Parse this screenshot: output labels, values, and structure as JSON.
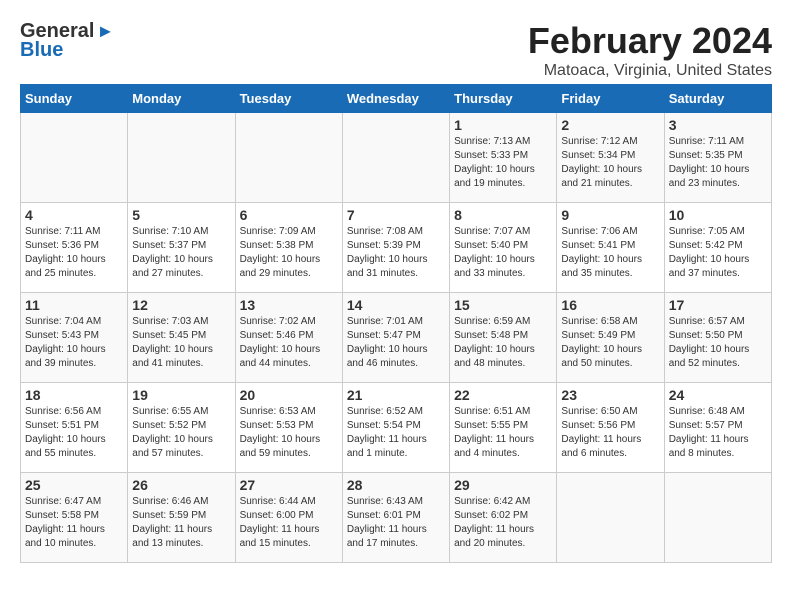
{
  "logo": {
    "line1": "General",
    "line2": "Blue"
  },
  "header": {
    "title": "February 2024",
    "subtitle": "Matoaca, Virginia, United States"
  },
  "weekdays": [
    "Sunday",
    "Monday",
    "Tuesday",
    "Wednesday",
    "Thursday",
    "Friday",
    "Saturday"
  ],
  "weeks": [
    [
      {
        "day": "",
        "info": ""
      },
      {
        "day": "",
        "info": ""
      },
      {
        "day": "",
        "info": ""
      },
      {
        "day": "",
        "info": ""
      },
      {
        "day": "1",
        "info": "Sunrise: 7:13 AM\nSunset: 5:33 PM\nDaylight: 10 hours\nand 19 minutes."
      },
      {
        "day": "2",
        "info": "Sunrise: 7:12 AM\nSunset: 5:34 PM\nDaylight: 10 hours\nand 21 minutes."
      },
      {
        "day": "3",
        "info": "Sunrise: 7:11 AM\nSunset: 5:35 PM\nDaylight: 10 hours\nand 23 minutes."
      }
    ],
    [
      {
        "day": "4",
        "info": "Sunrise: 7:11 AM\nSunset: 5:36 PM\nDaylight: 10 hours\nand 25 minutes."
      },
      {
        "day": "5",
        "info": "Sunrise: 7:10 AM\nSunset: 5:37 PM\nDaylight: 10 hours\nand 27 minutes."
      },
      {
        "day": "6",
        "info": "Sunrise: 7:09 AM\nSunset: 5:38 PM\nDaylight: 10 hours\nand 29 minutes."
      },
      {
        "day": "7",
        "info": "Sunrise: 7:08 AM\nSunset: 5:39 PM\nDaylight: 10 hours\nand 31 minutes."
      },
      {
        "day": "8",
        "info": "Sunrise: 7:07 AM\nSunset: 5:40 PM\nDaylight: 10 hours\nand 33 minutes."
      },
      {
        "day": "9",
        "info": "Sunrise: 7:06 AM\nSunset: 5:41 PM\nDaylight: 10 hours\nand 35 minutes."
      },
      {
        "day": "10",
        "info": "Sunrise: 7:05 AM\nSunset: 5:42 PM\nDaylight: 10 hours\nand 37 minutes."
      }
    ],
    [
      {
        "day": "11",
        "info": "Sunrise: 7:04 AM\nSunset: 5:43 PM\nDaylight: 10 hours\nand 39 minutes."
      },
      {
        "day": "12",
        "info": "Sunrise: 7:03 AM\nSunset: 5:45 PM\nDaylight: 10 hours\nand 41 minutes."
      },
      {
        "day": "13",
        "info": "Sunrise: 7:02 AM\nSunset: 5:46 PM\nDaylight: 10 hours\nand 44 minutes."
      },
      {
        "day": "14",
        "info": "Sunrise: 7:01 AM\nSunset: 5:47 PM\nDaylight: 10 hours\nand 46 minutes."
      },
      {
        "day": "15",
        "info": "Sunrise: 6:59 AM\nSunset: 5:48 PM\nDaylight: 10 hours\nand 48 minutes."
      },
      {
        "day": "16",
        "info": "Sunrise: 6:58 AM\nSunset: 5:49 PM\nDaylight: 10 hours\nand 50 minutes."
      },
      {
        "day": "17",
        "info": "Sunrise: 6:57 AM\nSunset: 5:50 PM\nDaylight: 10 hours\nand 52 minutes."
      }
    ],
    [
      {
        "day": "18",
        "info": "Sunrise: 6:56 AM\nSunset: 5:51 PM\nDaylight: 10 hours\nand 55 minutes."
      },
      {
        "day": "19",
        "info": "Sunrise: 6:55 AM\nSunset: 5:52 PM\nDaylight: 10 hours\nand 57 minutes."
      },
      {
        "day": "20",
        "info": "Sunrise: 6:53 AM\nSunset: 5:53 PM\nDaylight: 10 hours\nand 59 minutes."
      },
      {
        "day": "21",
        "info": "Sunrise: 6:52 AM\nSunset: 5:54 PM\nDaylight: 11 hours\nand 1 minute."
      },
      {
        "day": "22",
        "info": "Sunrise: 6:51 AM\nSunset: 5:55 PM\nDaylight: 11 hours\nand 4 minutes."
      },
      {
        "day": "23",
        "info": "Sunrise: 6:50 AM\nSunset: 5:56 PM\nDaylight: 11 hours\nand 6 minutes."
      },
      {
        "day": "24",
        "info": "Sunrise: 6:48 AM\nSunset: 5:57 PM\nDaylight: 11 hours\nand 8 minutes."
      }
    ],
    [
      {
        "day": "25",
        "info": "Sunrise: 6:47 AM\nSunset: 5:58 PM\nDaylight: 11 hours\nand 10 minutes."
      },
      {
        "day": "26",
        "info": "Sunrise: 6:46 AM\nSunset: 5:59 PM\nDaylight: 11 hours\nand 13 minutes."
      },
      {
        "day": "27",
        "info": "Sunrise: 6:44 AM\nSunset: 6:00 PM\nDaylight: 11 hours\nand 15 minutes."
      },
      {
        "day": "28",
        "info": "Sunrise: 6:43 AM\nSunset: 6:01 PM\nDaylight: 11 hours\nand 17 minutes."
      },
      {
        "day": "29",
        "info": "Sunrise: 6:42 AM\nSunset: 6:02 PM\nDaylight: 11 hours\nand 20 minutes."
      },
      {
        "day": "",
        "info": ""
      },
      {
        "day": "",
        "info": ""
      }
    ]
  ]
}
